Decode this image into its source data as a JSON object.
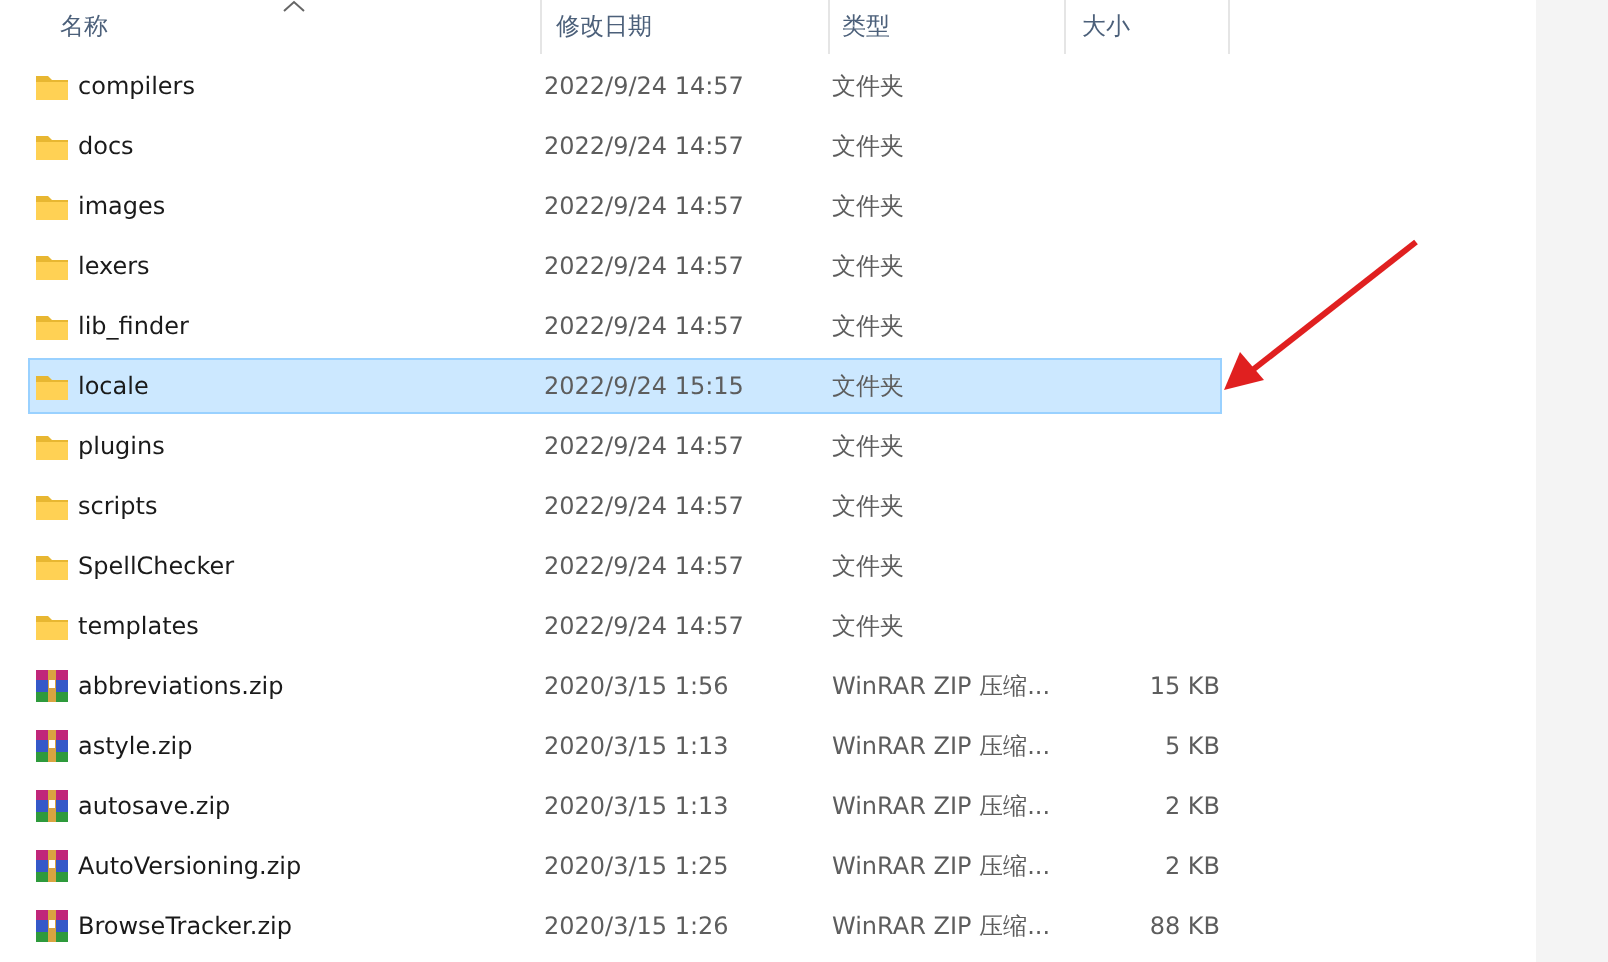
{
  "columns": [
    {
      "label": "名称",
      "sorted": true
    },
    {
      "label": "修改日期",
      "sorted": false
    },
    {
      "label": "类型",
      "sorted": false
    },
    {
      "label": "大小",
      "sorted": false
    }
  ],
  "rows": [
    {
      "kind": "folder",
      "name": "compilers",
      "date": "2022/9/24 14:57",
      "type": "文件夹",
      "selected": false
    },
    {
      "kind": "folder",
      "name": "docs",
      "date": "2022/9/24 14:57",
      "type": "文件夹",
      "selected": false
    },
    {
      "kind": "folder",
      "name": "images",
      "date": "2022/9/24 14:57",
      "type": "文件夹",
      "selected": false
    },
    {
      "kind": "folder",
      "name": "lexers",
      "date": "2022/9/24 14:57",
      "type": "文件夹",
      "selected": false
    },
    {
      "kind": "folder",
      "name": "lib_finder",
      "date": "2022/9/24 14:57",
      "type": "文件夹",
      "selected": false
    },
    {
      "kind": "folder",
      "name": "locale",
      "date": "2022/9/24 15:15",
      "type": "文件夹",
      "selected": true
    },
    {
      "kind": "folder",
      "name": "plugins",
      "date": "2022/9/24 14:57",
      "type": "文件夹",
      "selected": false
    },
    {
      "kind": "folder",
      "name": "scripts",
      "date": "2022/9/24 14:57",
      "type": "文件夹",
      "selected": false
    },
    {
      "kind": "folder",
      "name": "SpellChecker",
      "date": "2022/9/24 14:57",
      "type": "文件夹",
      "selected": false
    },
    {
      "kind": "folder",
      "name": "templates",
      "date": "2022/9/24 14:57",
      "type": "文件夹",
      "selected": false
    },
    {
      "kind": "archive",
      "name": "abbreviations.zip",
      "date": "2020/3/15 1:56",
      "type": "WinRAR ZIP 压缩...",
      "size": "15 KB",
      "selected": false
    },
    {
      "kind": "archive",
      "name": "astyle.zip",
      "date": "2020/3/15 1:13",
      "type": "WinRAR ZIP 压缩...",
      "size": "5 KB",
      "selected": false
    },
    {
      "kind": "archive",
      "name": "autosave.zip",
      "date": "2020/3/15 1:13",
      "type": "WinRAR ZIP 压缩...",
      "size": "2 KB",
      "selected": false
    },
    {
      "kind": "archive",
      "name": "AutoVersioning.zip",
      "date": "2020/3/15 1:25",
      "type": "WinRAR ZIP 压缩...",
      "size": "2 KB",
      "selected": false
    },
    {
      "kind": "archive",
      "name": "BrowseTracker.zip",
      "date": "2020/3/15 1:26",
      "type": "WinRAR ZIP 压缩...",
      "size": "88 KB",
      "selected": false
    }
  ]
}
